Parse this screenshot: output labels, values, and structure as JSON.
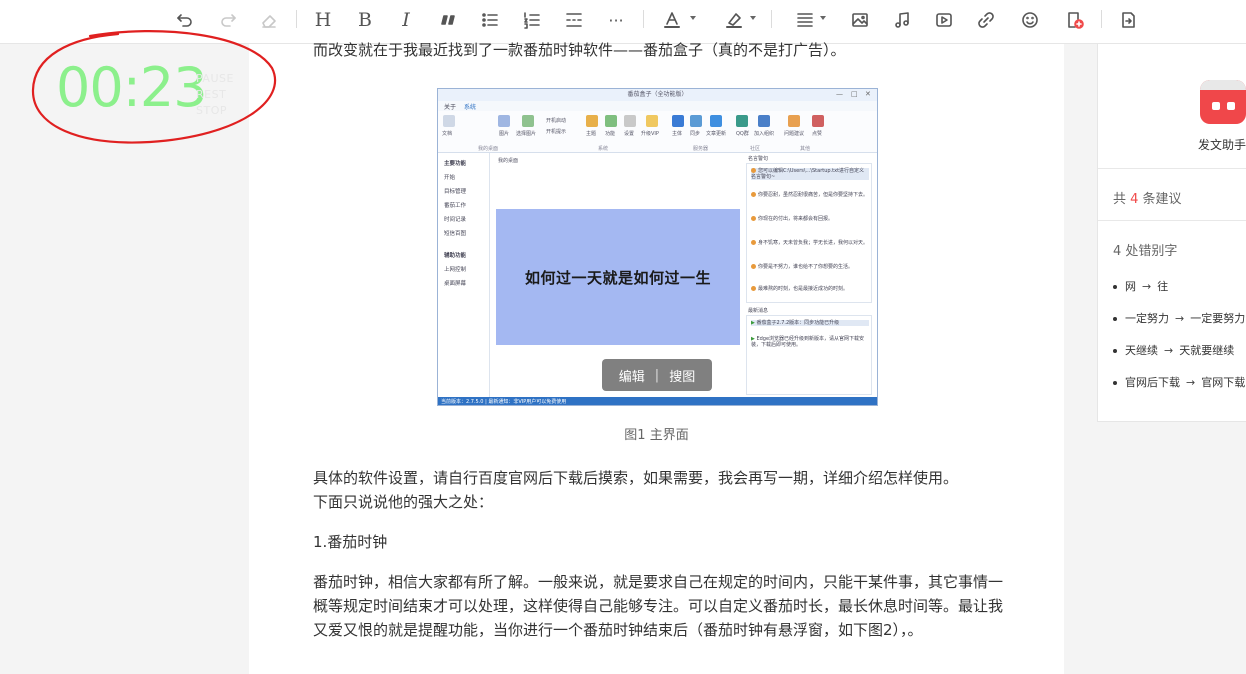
{
  "toolbar": {
    "heading_label": "H",
    "bold_label": "B",
    "italic_label": "I",
    "more_label": "···"
  },
  "article": {
    "paragraph_top": "而改变就在于我最近找到了一款番茄时钟软件——番茄盒子（真的不是打广告）。",
    "figure_caption": "图1 主界面",
    "paragraph_setup_a": "具体的软件设置，请自行百度官网后下载后摸索，如果需要，我会再写一期，详细介绍怎样使用。",
    "paragraph_setup_b": "下面只说说他的强大之处：",
    "section_heading": "1.番茄时钟",
    "paragraph_body": "番茄时钟，相信大家都有所了解。一般来说，就是要求自己在规定的时间内，只能干某件事，其它事情一概等规定时间结束才可以处理，这样使得自己能够专注。可以自定义番茄时长，最长休息时间等。最让我又爱又恨的就是提醒功能，当你进行一个番茄时钟结束后（番茄时钟有悬浮窗，如下图2），。"
  },
  "screenshot": {
    "window_title": "番茄盒子（全功能版）",
    "tab_about": "关于",
    "tab_system": "系统",
    "ribbon_labels": [
      "文档",
      "图片",
      "选择图片",
      "开机启动",
      "开机提示",
      "主题",
      "功能",
      "设置",
      "升级VIP",
      "主体",
      "同步",
      "文章更新",
      "QQ群",
      "加入组织",
      "问题建议",
      "点赞"
    ],
    "ribbon_groups": [
      "我的桌面",
      "系统",
      "服务器",
      "社区",
      "其他"
    ],
    "side_title_main": "主要功能",
    "side_items_main": [
      "开始",
      "目标管理",
      "番茄工作",
      "时间记录",
      "短信百图"
    ],
    "side_title_aux": "辅助功能",
    "side_items_aux": [
      "上网控制",
      "桌面屏幕"
    ],
    "desktop_label": "我的桌面",
    "poster_text": "如何过一天就是如何过一生",
    "edit_button": "编辑",
    "search_button": "搜图",
    "tips_title": "名言警句",
    "tips": [
      "您可以编辑C:\\Users\\...\\Startup.txt进行自定义名言警句~",
      "你要忍耐，虽然忍耐很痛苦，但是你要坚持下去。",
      "你现在的付出，将来都会有回报。",
      "身不饥寒，天未曾负我；学无长进，我何以对天。",
      "你要是不努力，谁也给不了你想要的生活。",
      "最难熬的时刻，也是最接近成功的时刻。"
    ],
    "news_title": "最新消息",
    "news": [
      "番茄盒子2.7.2版本：同步功能已升级",
      "Edge浏览器已经升级到新版本，请从官网下载安装，下载后即可使用。"
    ],
    "status_text": "当前版本：2.7.5.0 | 最新通知：非VIP用户可以免费使用"
  },
  "timer": {
    "value": "00:23",
    "pause_label": "PAUSE",
    "rest_label": "REST",
    "stop_label": "STOP"
  },
  "panel": {
    "assistant_name": "发文助手",
    "suggest_prefix": "共 ",
    "suggest_count": "4",
    "suggest_suffix": " 条建议",
    "typo_title": "4 处错别字",
    "fixes": [
      {
        "from": "网",
        "to": "往"
      },
      {
        "from": "一定努力",
        "to": "一定要努力"
      },
      {
        "from": "天继续",
        "to": "天就要继续"
      },
      {
        "from": "官网后下载",
        "to": "官网下载"
      }
    ]
  },
  "colors": {
    "timer_green": "#8cf08c",
    "circle_red": "#e02020",
    "suggest_red": "#f04a4a",
    "poster_blue": "#a4b8f2",
    "status_blue": "#2f72c4"
  }
}
